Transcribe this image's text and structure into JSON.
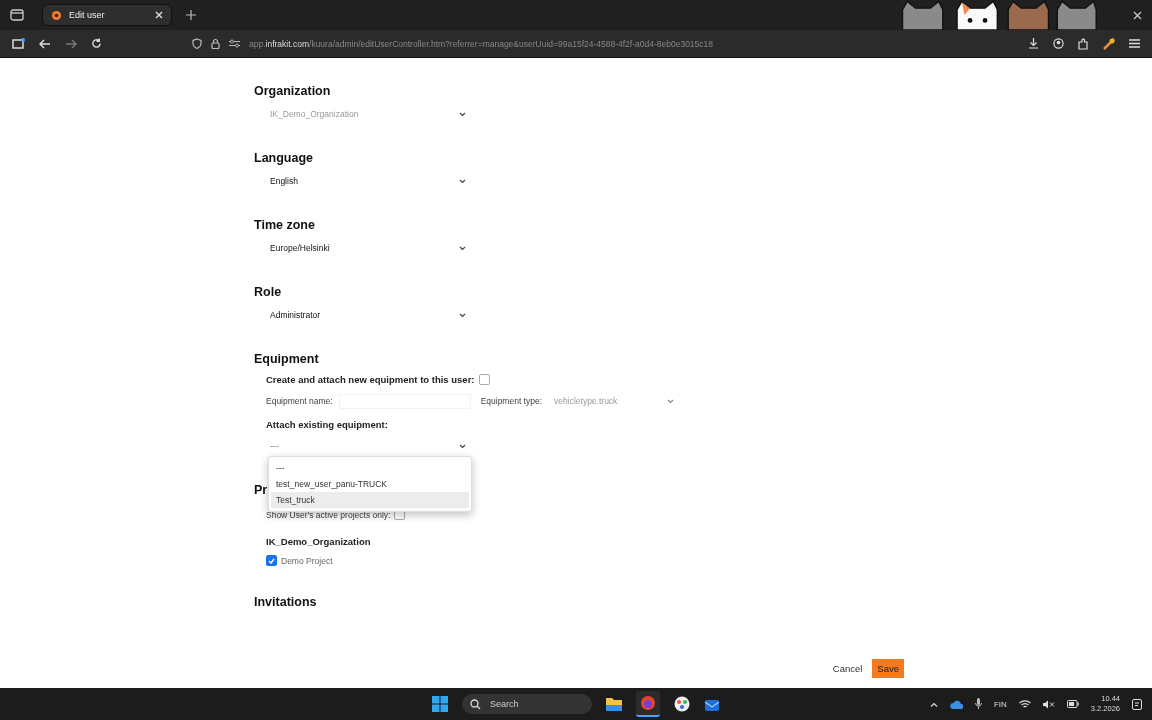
{
  "browser": {
    "tab_title": "Edit user",
    "url_prefix": "app.",
    "url_domain": "infrakit.com",
    "url_path": "/kuura/admin/editUserController.htm?referrer=manage&userUuid=99a15f24-4588-4f2f-a0d4-8eb0e3015c18"
  },
  "fields": [
    {
      "label": "Organization",
      "value": "IK_Demo_Organization",
      "disabled": true
    },
    {
      "label": "Language",
      "value": "English",
      "disabled": false
    },
    {
      "label": "Time zone",
      "value": "Europe/Helsinki",
      "disabled": false
    },
    {
      "label": "Role",
      "value": "Administrator",
      "disabled": false
    }
  ],
  "equipment": {
    "heading": "Equipment",
    "create_label": "Create and attach new equipment to this user:",
    "create_checked": false,
    "name_label": "Equipment name:",
    "type_label": "Equipment type:",
    "type_value": "vehicletype.truck",
    "attach_label": "Attach existing equipment:",
    "attach_value": "---",
    "options": [
      {
        "label": "---",
        "selected": false
      },
      {
        "label": "test_new_user_panu-TRUCK",
        "selected": false
      },
      {
        "label": "Test_truck",
        "selected": true
      }
    ]
  },
  "projects": {
    "heading": "Pr",
    "show_active_label": "Show User's active projects only:",
    "show_active_checked": false,
    "organization": "IK_Demo_Organization",
    "items": [
      {
        "label": "Demo Project",
        "checked": true
      }
    ]
  },
  "invitations": {
    "heading": "Invitations"
  },
  "buttons": {
    "cancel": "Cancel",
    "save": "Save"
  },
  "taskbar": {
    "search_placeholder": "Search",
    "language": "FIN",
    "time": "10.44",
    "date": "3.2.2026"
  }
}
